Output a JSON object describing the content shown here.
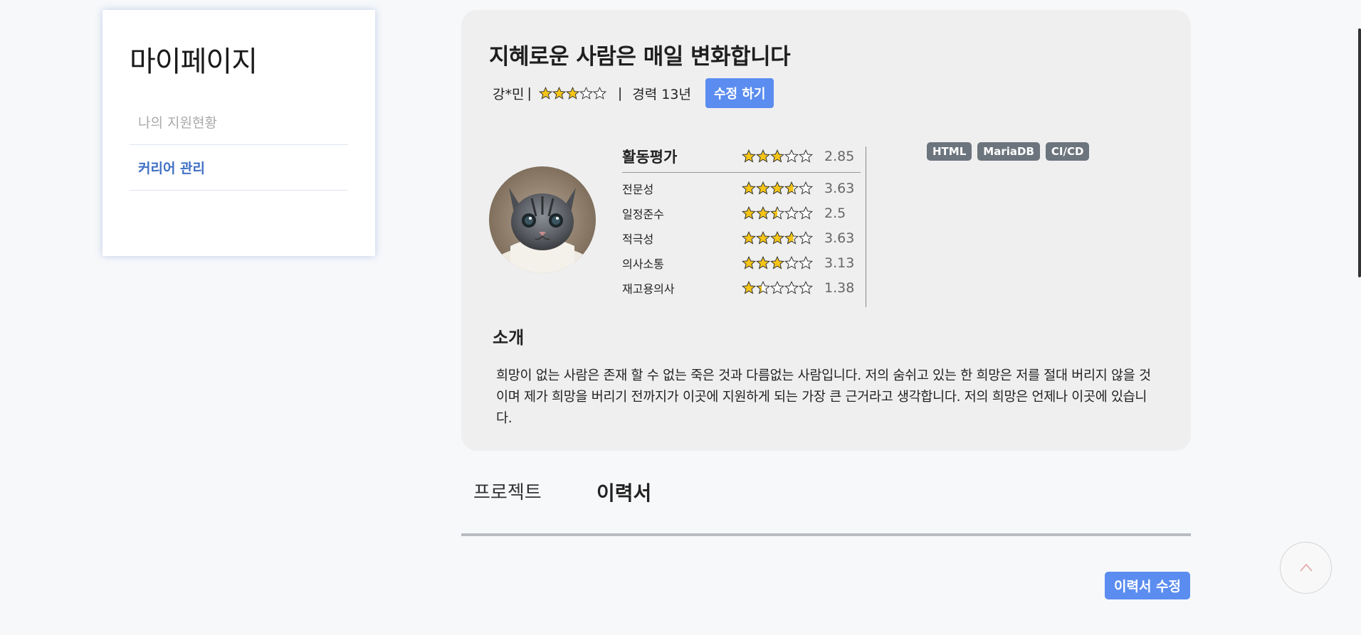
{
  "sidebar": {
    "title": "마이페이지",
    "items": [
      {
        "label": "나의 지원현황",
        "active": false
      },
      {
        "label": "커리어 관리",
        "active": true
      }
    ]
  },
  "profile": {
    "headline": "지혜로운 사람은 매일 변화합니다",
    "name": "강*민",
    "name_sep": "|",
    "overall_stars": 3,
    "exp_sep": "|",
    "experience": "경력 13년",
    "edit_button": "수정 하기",
    "avatar_icon": "kitten-photo"
  },
  "ratings": {
    "main": {
      "label": "활동평가",
      "value": "2.85"
    },
    "items": [
      {
        "label": "전문성",
        "value": "3.63"
      },
      {
        "label": "일정준수",
        "value": "2.5"
      },
      {
        "label": "적극성",
        "value": "3.63"
      },
      {
        "label": "의사소통",
        "value": "3.13"
      },
      {
        "label": "재고용의사",
        "value": "1.38"
      }
    ]
  },
  "tags": [
    "HTML",
    "MariaDB",
    "CI/CD"
  ],
  "intro": {
    "title": "소개",
    "text": "희망이 없는 사람은 존재 할 수 없는 죽은 것과 다름없는 사람입니다. 저의 숨쉬고 있는 한 희망은 저를 절대 버리지 않을 것이며 제가 희망을 버리기 전까지가 이곳에 지원하게 되는 가장 큰 근거라고 생각합니다. 저의 희망은 언제나 이곳에 있습니다."
  },
  "tabs": [
    {
      "label": "프로젝트",
      "active": false
    },
    {
      "label": "이력서",
      "active": true
    }
  ],
  "resume_edit_button": "이력서 수정",
  "colors": {
    "accent": "#5b8df0",
    "active_menu": "#3f6fc4",
    "tag_bg": "#6c757d",
    "star_fill": "#f5c518",
    "card_bg": "#efefef"
  },
  "icons": {
    "scroll_top": "chevron-up-icon",
    "star": "star-icon"
  }
}
